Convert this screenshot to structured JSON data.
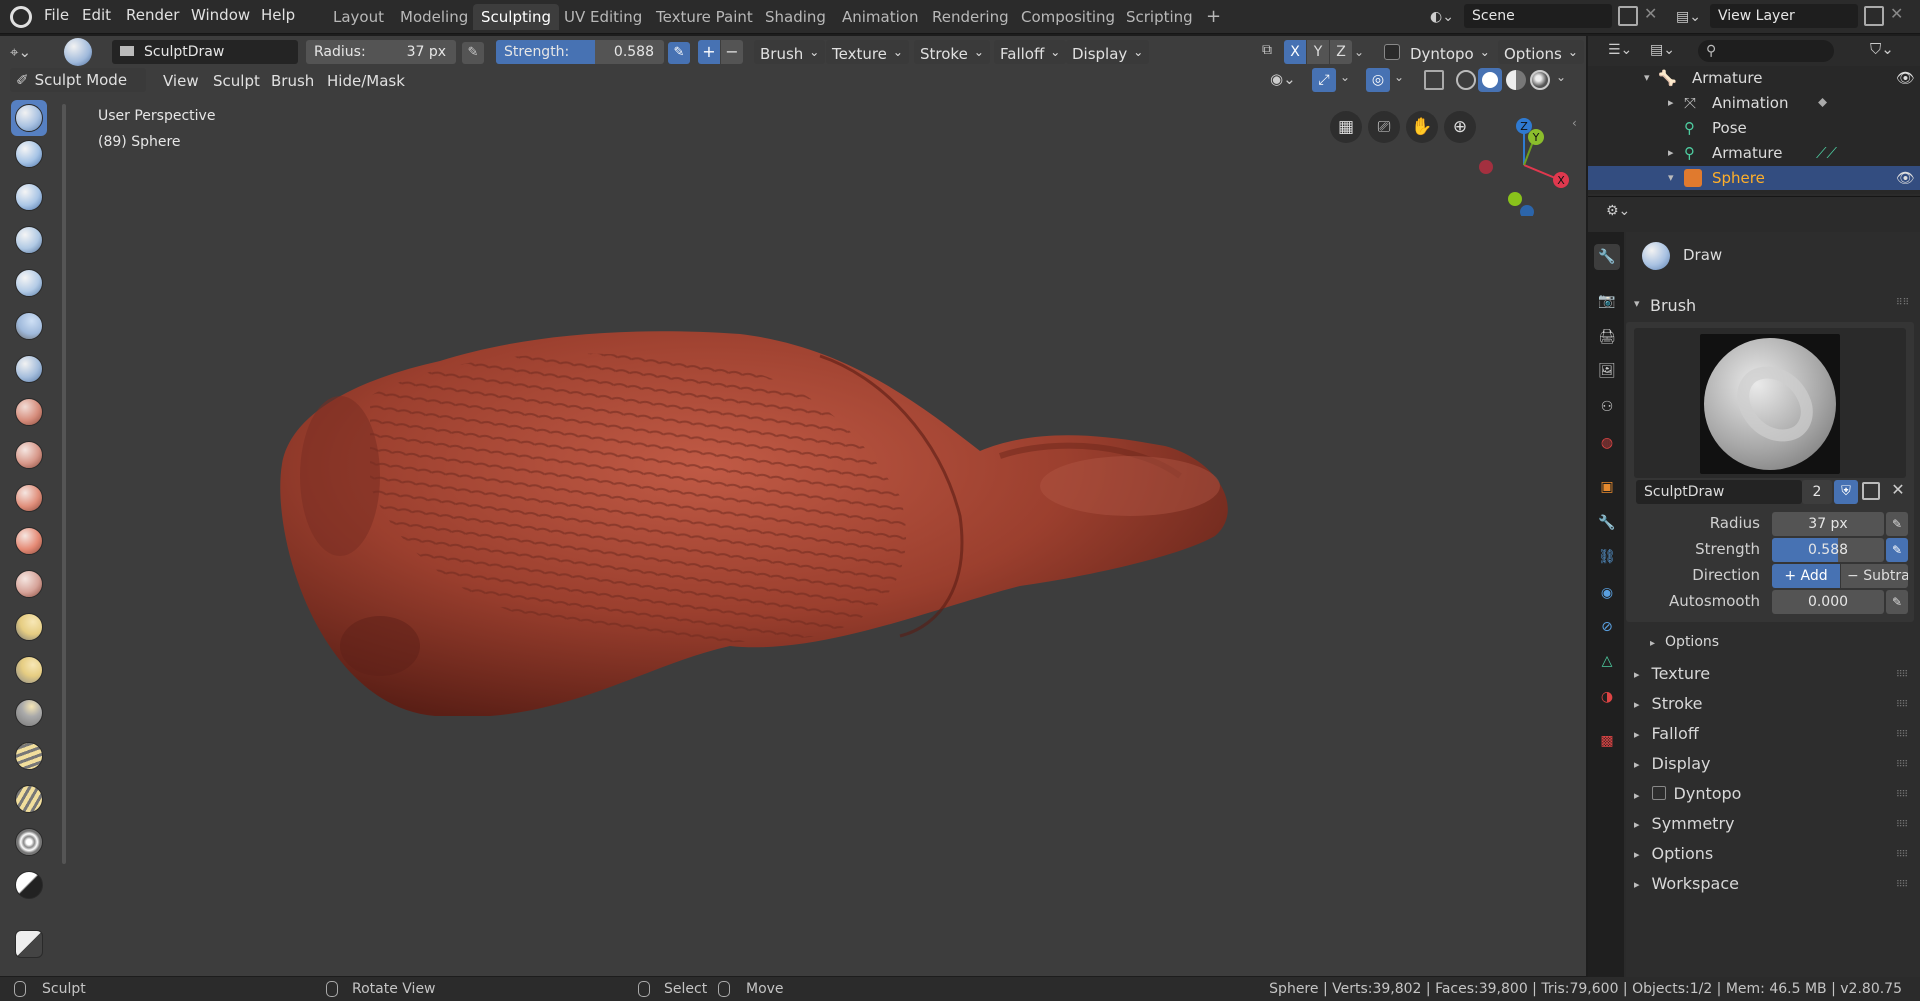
{
  "menus": [
    "File",
    "Edit",
    "Render",
    "Window",
    "Help"
  ],
  "workspace_tabs": [
    "Layout",
    "Modeling",
    "Sculpting",
    "UV Editing",
    "Texture Paint",
    "Shading",
    "Animation",
    "Rendering",
    "Compositing",
    "Scripting"
  ],
  "active_tab": "Sculpting",
  "scene": "Scene",
  "view_layer": "View Layer",
  "tool_header": {
    "brush_name": "SculptDraw",
    "radius_label": "Radius:",
    "radius_value": "37 px",
    "strength_label": "Strength:",
    "strength_value": "0.588",
    "strength_fraction": 0.588,
    "dropdowns": [
      "Brush",
      "Texture",
      "Stroke",
      "Falloff",
      "Display"
    ],
    "axes": [
      "X",
      "Y",
      "Z"
    ],
    "dyntopo": "Dyntopo",
    "options": "Options"
  },
  "mode_header": {
    "mode": "Sculpt Mode",
    "menus": [
      "View",
      "Sculpt",
      "Brush",
      "Hide/Mask"
    ]
  },
  "viewport": {
    "perspective": "User Perspective",
    "object_info": "(89) Sphere"
  },
  "outliner": {
    "items": [
      {
        "label": "Armature",
        "color": "#e0e0e0"
      },
      {
        "label": "Animation",
        "color": "#e0e0e0"
      },
      {
        "label": "Pose",
        "color": "#e0e0e0"
      },
      {
        "label": "Armature",
        "color": "#e0e0e0"
      },
      {
        "label": "Sphere",
        "color": "#ffaf29"
      }
    ]
  },
  "properties": {
    "brush_title": "Draw",
    "panel_brush": "Brush",
    "brush_name": "SculptDraw",
    "brush_users": "2",
    "radius_label": "Radius",
    "radius_value": "37 px",
    "strength_label": "Strength",
    "strength_value": "0.588",
    "direction_label": "Direction",
    "direction_add": "Add",
    "direction_sub": "Subtra",
    "autosmooth_label": "Autosmooth",
    "autosmooth_value": "0.000",
    "options_sub": "Options",
    "sections": [
      "Texture",
      "Stroke",
      "Falloff",
      "Display",
      "Dyntopo",
      "Symmetry",
      "Options",
      "Workspace"
    ]
  },
  "statusbar": {
    "left": "Sculpt",
    "rotate": "Rotate View",
    "select": "Select",
    "move": "Move",
    "stats": "Sphere | Verts:39,802 | Faces:39,800 | Tris:79,600 | Objects:1/2 | Mem: 46.5 MB | v2.80.75"
  },
  "colors": {
    "accent": "#4772b3",
    "selected": "#334d80",
    "object_orange": "#ffaf29",
    "mesh": "#8f3524"
  }
}
